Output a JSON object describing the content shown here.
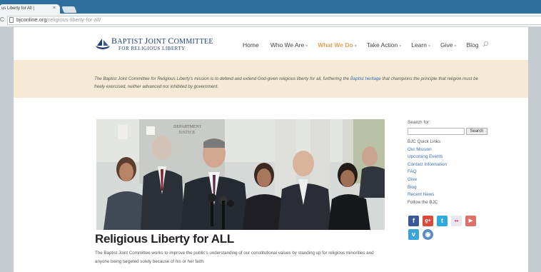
{
  "browser": {
    "tab_title": "us Liberty for All | ",
    "tab_close": "×",
    "reload": "C",
    "url_host": "bjconline.org",
    "url_path": "/religious-liberty-for-all/"
  },
  "header": {
    "logo_line1_a": "B",
    "logo_line1_b": "APTIST ",
    "logo_line1_c": "J",
    "logo_line1_d": "OINT ",
    "logo_line1_e": "C",
    "logo_line1_f": "OMMITTEE",
    "logo_line2": "FOR RELIGIOUS LIBERTY",
    "nav": [
      {
        "label": "Home",
        "caret": ""
      },
      {
        "label": "Who We Are",
        "caret": "▾"
      },
      {
        "label": "What We Do",
        "caret": "▾"
      },
      {
        "label": "Take Action",
        "caret": "▾"
      },
      {
        "label": "Learn",
        "caret": "▾"
      },
      {
        "label": "Give",
        "caret": "▾"
      },
      {
        "label": "Blog",
        "caret": ""
      }
    ]
  },
  "mission": {
    "text_before": "The Baptist Joint Committee for Religious Liberty's mission is to defend and extend God-given religious liberty for all, furthering the ",
    "link": "Baptist heritage",
    "text_after": " that champions the principle that religion must be freely exercised, neither advanced nor inhibited by government."
  },
  "hero": {
    "sign_line1": "DEPARTMENT",
    "sign_line2": "JUSTICE"
  },
  "article": {
    "title": "Religious Liberty for ALL",
    "body": "The Baptist Joint Committee works to improve the public's understanding of our constitutional values by standing up for religious minorities and anyone being targeted solely because of his or her faith."
  },
  "sidebar": {
    "search_label": "Search for:",
    "search_button": "Search",
    "links": [
      {
        "label": "BJC Quick Links",
        "plain": true
      },
      {
        "label": "Our Mission",
        "plain": false
      },
      {
        "label": "Upcoming Events",
        "plain": false
      },
      {
        "label": "Contact Information",
        "plain": false
      },
      {
        "label": "FAQ",
        "plain": false
      },
      {
        "label": "Give",
        "plain": false
      },
      {
        "label": "Blog",
        "plain": false
      },
      {
        "label": "Recent News",
        "plain": false
      },
      {
        "label": "Follow the BJC",
        "plain": true
      }
    ],
    "social": [
      {
        "name": "facebook-icon",
        "glyph": "f",
        "color": "#3b5998"
      },
      {
        "name": "google-plus-icon",
        "glyph": "g+",
        "color": "#d94a38"
      },
      {
        "name": "twitter-icon",
        "glyph": "t",
        "color": "#2fa9e0"
      },
      {
        "name": "flickr-icon",
        "glyph": "••",
        "color": "#e8e8ee"
      },
      {
        "name": "youtube-icon",
        "glyph": "▶",
        "color": "#e0706a"
      },
      {
        "name": "vimeo-icon",
        "glyph": "v",
        "color": "#3aa5d6"
      },
      {
        "name": "blog-rss-icon",
        "glyph": "◉",
        "color": "#5a8bc4"
      }
    ]
  },
  "colors": {
    "accent_active_nav": "#e0a25a",
    "mission_bg": "#f5ead4",
    "link": "#3a6fb0",
    "logo": "#1f3f78",
    "tabstrip": "#2f6f9f"
  }
}
